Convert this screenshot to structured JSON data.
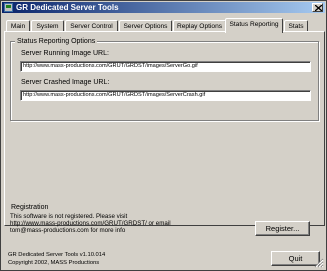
{
  "window": {
    "title": "GR Dedicated Server Tools"
  },
  "tabs": [
    {
      "label": "Main"
    },
    {
      "label": "System"
    },
    {
      "label": "Server Control"
    },
    {
      "label": "Server Options"
    },
    {
      "label": "Replay Options"
    },
    {
      "label": "Status Reporting",
      "active": true
    },
    {
      "label": "Stats"
    }
  ],
  "status_reporting": {
    "group_title": "Status Reporting Options",
    "running_label": "Server Running Image URL:",
    "running_value": "http://www.mass-productions.com/GRUT/GRDST/images/ServerGo.gif",
    "crashed_label": "Server Crashed Image URL:",
    "crashed_value": "http://www.mass-productions.com/GRUT/GRDST/images/ServerCrash.gif"
  },
  "registration": {
    "group_title": "Registration",
    "text_line1": "This software is not registered. Please visit",
    "text_line2": "http://www.mass-productions.com/GRUT/GRDST/ or email",
    "text_line3": "tom@mass-productions.com for more info",
    "register_button": "Register..."
  },
  "footer": {
    "version": "GR Dedicated Server Tools v1.10.014",
    "copyright": "Copyright 2002, MASS Productions",
    "quit_button": "Quit"
  }
}
